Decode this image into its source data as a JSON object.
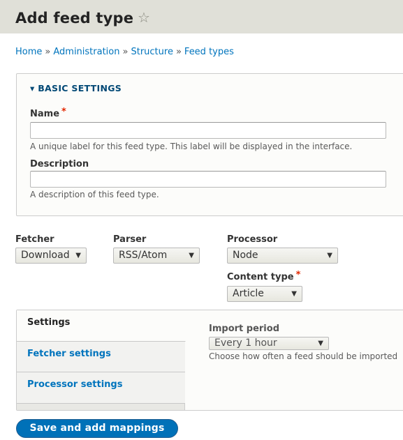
{
  "header": {
    "title": "Add feed type",
    "star_icon": "star-outline-icon"
  },
  "breadcrumb": {
    "items": [
      "Home",
      "Administration",
      "Structure",
      "Feed types"
    ],
    "separator": "»"
  },
  "basic_settings": {
    "legend": "▾ BASIC SETTINGS",
    "name": {
      "label": "Name",
      "required_marker": "*",
      "value": "",
      "description": "A unique label for this feed type. This label will be displayed in the interface."
    },
    "description": {
      "label": "Description",
      "value": "",
      "description": "A description of this feed type."
    }
  },
  "plugins": {
    "fetcher": {
      "label": "Fetcher",
      "selected": "Download"
    },
    "parser": {
      "label": "Parser",
      "selected": "RSS/Atom"
    },
    "processor": {
      "label": "Processor",
      "selected": "Node"
    },
    "content_type": {
      "label": "Content type",
      "required_marker": "*",
      "selected": "Article"
    }
  },
  "vertical_tabs": {
    "tabs": [
      "Settings",
      "Fetcher settings",
      "Processor settings"
    ],
    "active": "Settings",
    "import_period": {
      "label": "Import period",
      "selected": "Every 1 hour",
      "description": "Choose how often a feed should be imported"
    }
  },
  "actions": {
    "submit_label": "Save and add mappings"
  },
  "dropdown_arrow": "▼",
  "colors": {
    "link": "#0074bd",
    "primary_button": "#0071b8",
    "required": "#e32700",
    "header_bg": "#e0e0d8"
  }
}
